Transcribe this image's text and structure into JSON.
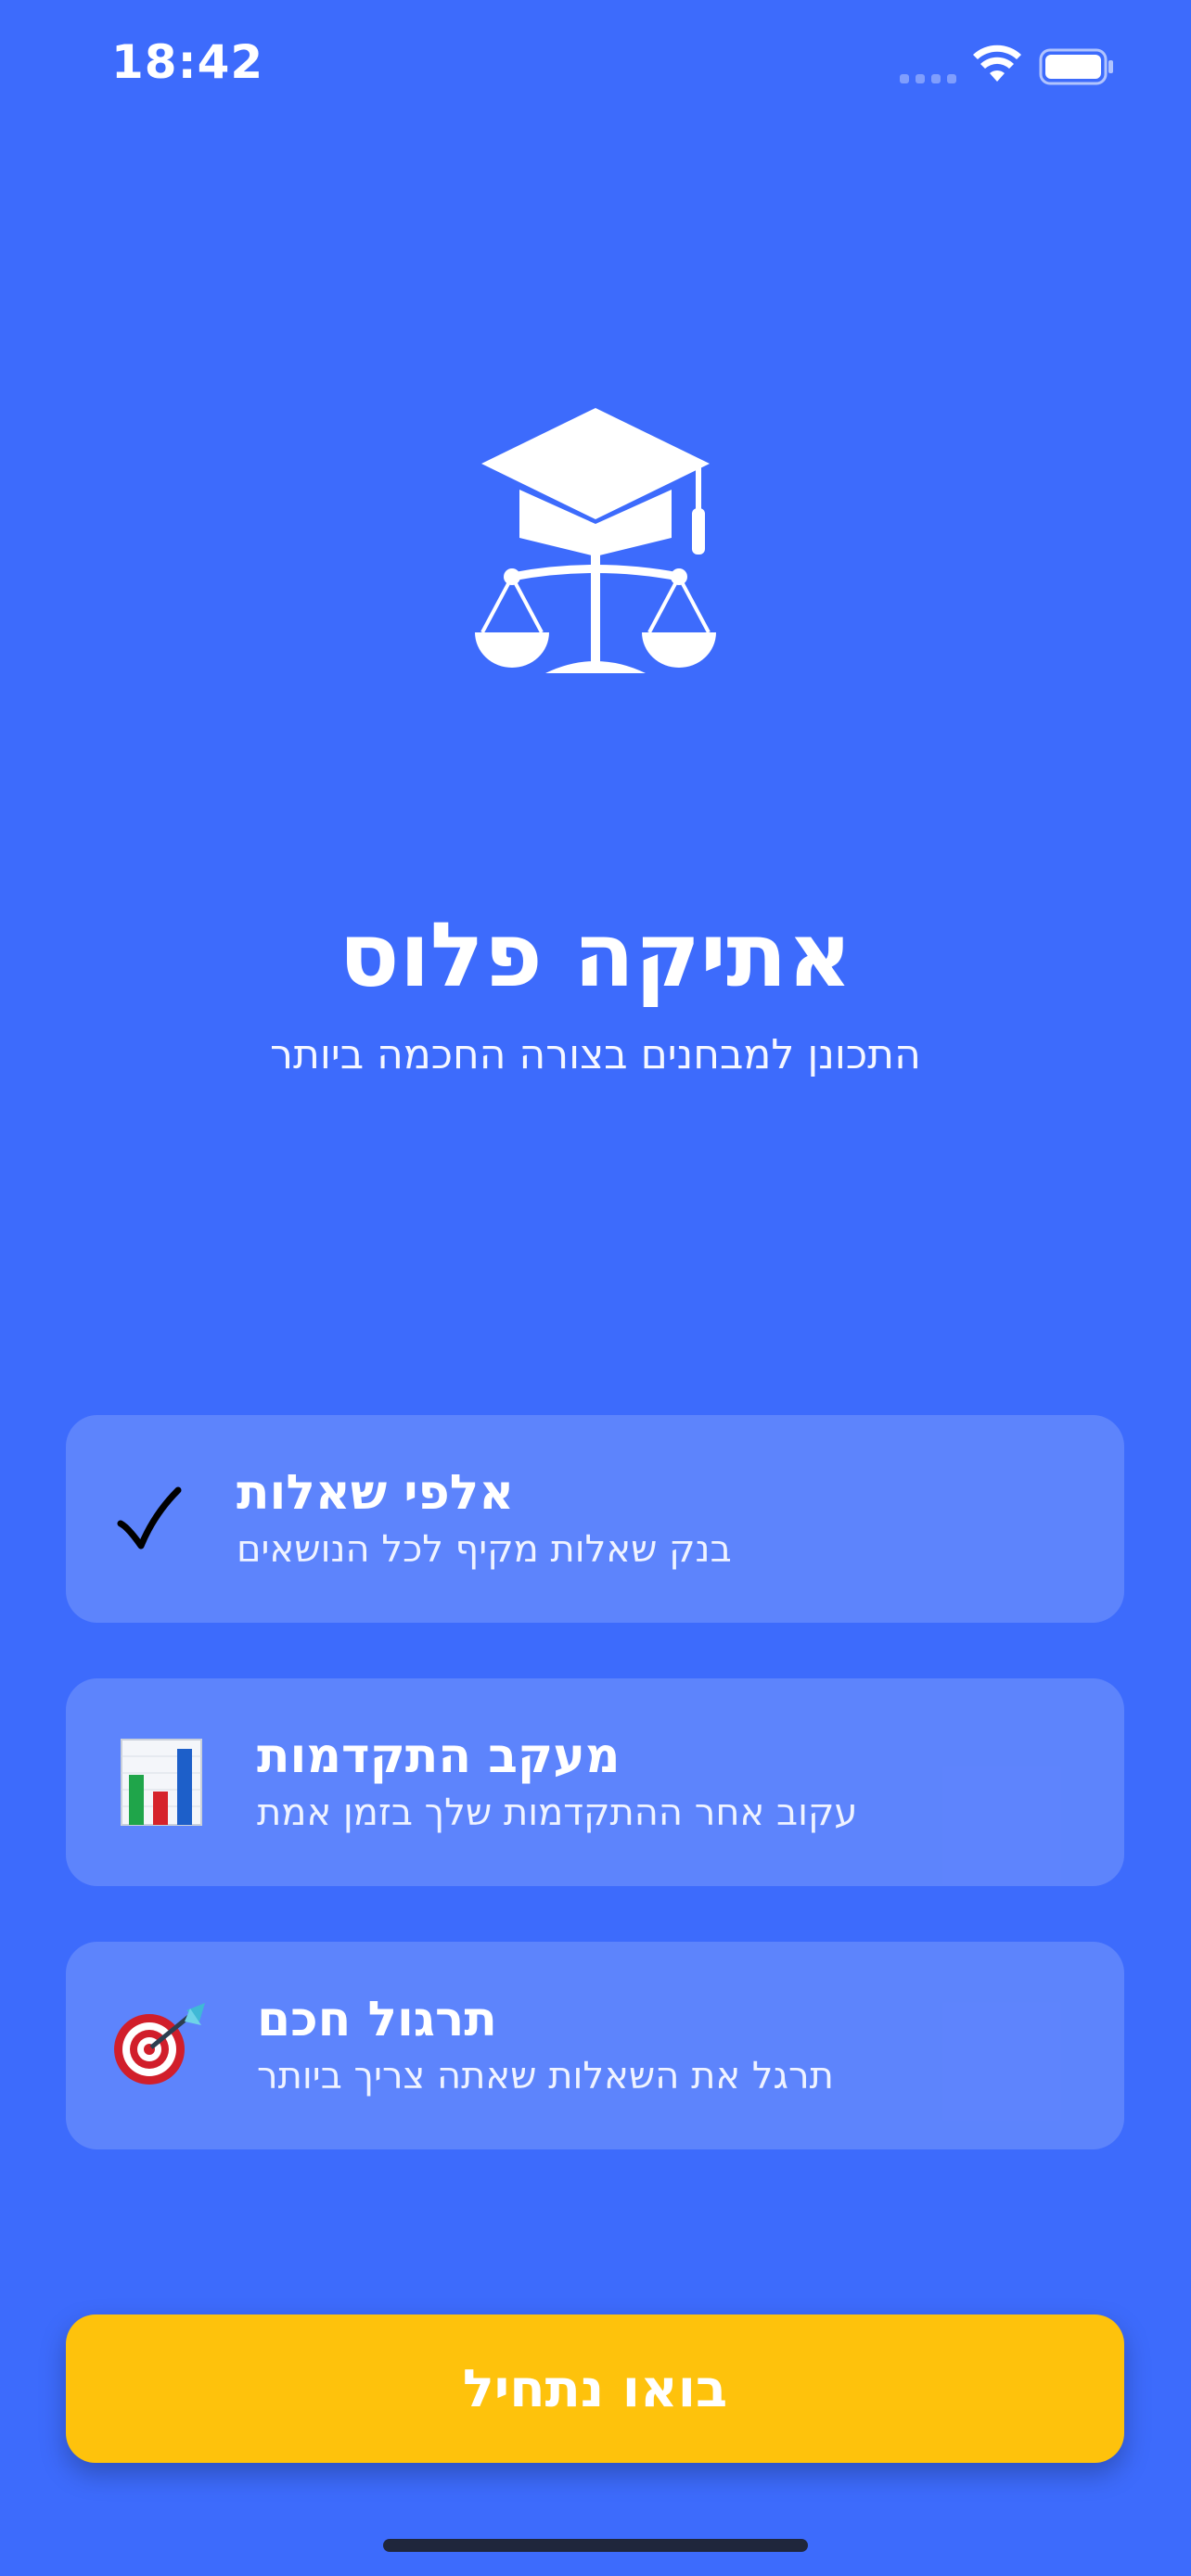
{
  "status_bar": {
    "time": "18:42",
    "icons": [
      "cellular-signal-icon",
      "wifi-icon",
      "battery-icon"
    ]
  },
  "logo": {
    "icon": "graduation-cap-scales-icon"
  },
  "app": {
    "title": "אתיקה פלוס",
    "subtitle": "התכונן למבחנים בצורה החכמה ביותר"
  },
  "features": [
    {
      "icon": "checkmark-icon",
      "title": "אלפי שאלות",
      "description": "בנק שאלות מקיף לכל הנושאים"
    },
    {
      "icon": "bar-chart-icon",
      "title": "מעקב התקדמות",
      "description": "עקוב אחר ההתקדמות שלך בזמן אמת"
    },
    {
      "icon": "dart-target-icon",
      "title": "תרגול חכם",
      "description": "תרגל את השאלות שאתה צריך ביותר"
    }
  ],
  "cta": {
    "label": "בואו נתחיל"
  },
  "colors": {
    "background": "#3D6BFC",
    "card": "#5B82FD",
    "button": "#FEC20C",
    "text": "#FFFFFF"
  }
}
